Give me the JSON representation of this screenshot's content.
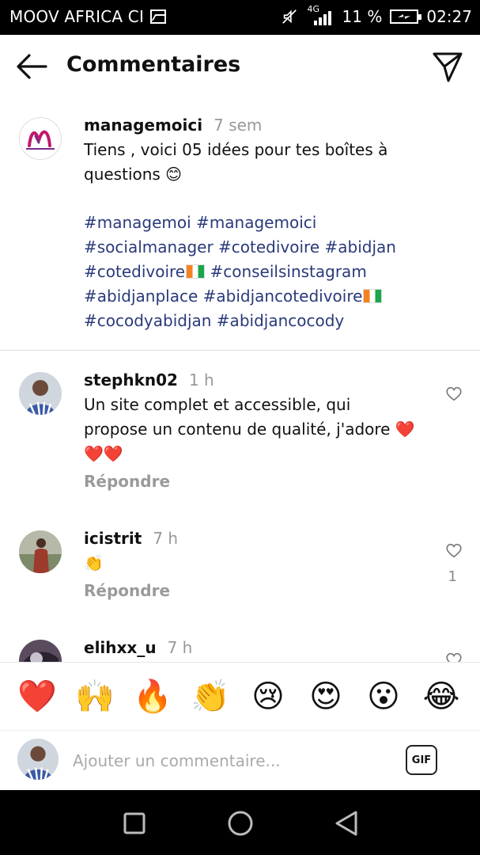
{
  "status_bar": {
    "carrier": "MOOV AFRICA CI",
    "network": "4G",
    "battery_percent": "11 %",
    "time": "02:27",
    "icons": [
      "image-icon",
      "mute-icon",
      "signal-icon",
      "battery-charging-icon"
    ]
  },
  "header": {
    "title": "Commentaires",
    "icons": [
      "back-arrow-icon",
      "send-icon"
    ]
  },
  "caption": {
    "username": "managemoici",
    "time": "7 sem",
    "text": "Tiens , voici 05 idées pour tes boîtes à questions 😊",
    "hashtags": [
      "#managemoi #managemoici",
      "#socialmanager #cotedivoire #abidjan",
      "#cotedivoire",
      "#conseilsinstagram",
      "#abidjanplace #abidjancotedivoire",
      "#cocodyabidjan #abidjancocody"
    ]
  },
  "comments": [
    {
      "username": "stephkn02",
      "time": "1 h",
      "text": "Un site complet et accessible, qui propose un contenu de qualité, j'adore ❤️❤️❤️",
      "reply_label": "Répondre",
      "likes": ""
    },
    {
      "username": "icistrit",
      "time": "7 h",
      "text": "👏",
      "reply_label": "Répondre",
      "likes": "1"
    },
    {
      "username": "elihxx_u",
      "time": "7 h",
      "text": ""
    }
  ],
  "emoji_bar": [
    "❤️",
    "🙌",
    "🔥",
    "👏",
    "😢",
    "😍",
    "😮",
    "😂"
  ],
  "input": {
    "placeholder": "Ajouter un commentaire...",
    "gif_label": "GIF"
  },
  "nav_bar": {
    "icons": [
      "recent-apps-icon",
      "home-icon",
      "back-icon"
    ]
  }
}
